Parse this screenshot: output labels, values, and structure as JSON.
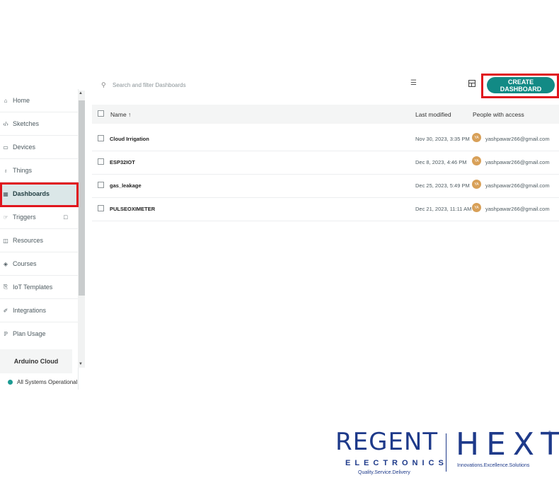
{
  "sidebar": {
    "items": [
      {
        "label": "Home",
        "icon": "home-icon",
        "glyph": "⌂"
      },
      {
        "label": "Sketches",
        "icon": "code-icon",
        "glyph": "‹/›"
      },
      {
        "label": "Devices",
        "icon": "device-icon",
        "glyph": "▭"
      },
      {
        "label": "Things",
        "icon": "things-icon",
        "glyph": "♁"
      },
      {
        "label": "Dashboards",
        "icon": "dashboard-icon",
        "glyph": "▦"
      },
      {
        "label": "Triggers",
        "icon": "trigger-icon",
        "glyph": "☞"
      },
      {
        "label": "Resources",
        "icon": "resources-icon",
        "glyph": "◫"
      },
      {
        "label": "Courses",
        "icon": "courses-icon",
        "glyph": "◈"
      },
      {
        "label": "IoT Templates",
        "icon": "template-icon",
        "glyph": "⎘"
      },
      {
        "label": "Integrations",
        "icon": "integration-icon",
        "glyph": "✐"
      },
      {
        "label": "Plan Usage",
        "icon": "plan-icon",
        "glyph": "ℙ"
      }
    ],
    "active": "Dashboards",
    "lock_glyph": "🔒",
    "cloud_label": "Arduino Cloud",
    "status_text": "All Systems Operational",
    "status_color": "#1c9b93"
  },
  "toolbar": {
    "search_placeholder": "Search and filter Dashboards",
    "create_label": "CREATE DASHBOARD",
    "accent": "#128a85"
  },
  "table": {
    "columns": {
      "name": "Name ↑",
      "modified": "Last modified",
      "people": "People with access"
    },
    "rows": [
      {
        "name": "Cloud Irrigation",
        "date": "Nov 30, 2023, 3:35 PM",
        "initials": "YA",
        "email": "yashpawar266@gmail.com"
      },
      {
        "name": "ESP32IOT",
        "date": "Dec 8, 2023, 4:46 PM",
        "initials": "YA",
        "email": "yashpawar266@gmail.com"
      },
      {
        "name": "gas_leakage",
        "date": "Dec 25, 2023, 5:49 PM",
        "initials": "YA",
        "email": "yashpawar266@gmail.com"
      },
      {
        "name": "PULSEOXIMETER",
        "date": "Dec 21, 2023, 11:11 AM",
        "initials": "YA",
        "email": "yashpawar266@gmail.com"
      }
    ]
  },
  "logo": {
    "regent": "REGENT",
    "electronics": "ELECTRONICS",
    "tagline": "Quality.Service.Delivery",
    "hext": "HEXT",
    "hext_tagline": "Innovations.Excellence.Solutions",
    "reg_mark": "®"
  }
}
